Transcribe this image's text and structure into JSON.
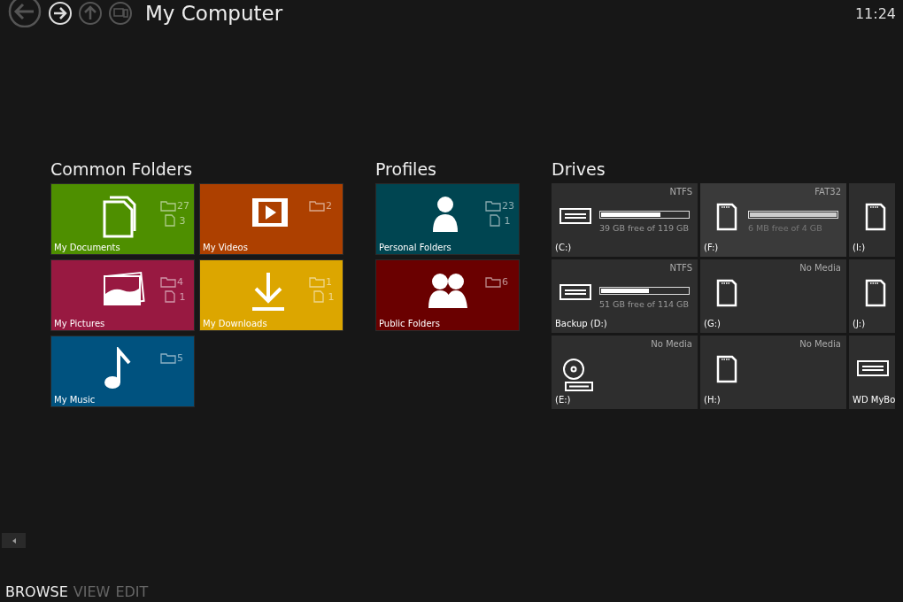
{
  "nav": [
    {
      "kind": "back",
      "disabled": true
    },
    {
      "kind": "forward",
      "disabled": false
    },
    {
      "kind": "up",
      "disabled": true
    },
    {
      "kind": "computer",
      "disabled": true
    }
  ],
  "title": "My Computer",
  "clock": "11:24",
  "common_folders": {
    "title": "Common Folders",
    "tiles": [
      {
        "label": "My Documents",
        "kind": "documents",
        "color": "#4e8f00",
        "folders": "27",
        "files": "3"
      },
      {
        "label": "My Videos",
        "kind": "videos",
        "color": "#ad4000",
        "folders": "2"
      },
      {
        "label": "My Pictures",
        "kind": "pictures",
        "color": "#981941",
        "folders": "4",
        "files": "1"
      },
      {
        "label": "My Downloads",
        "kind": "downloads",
        "color": "#dca600",
        "folders": "1",
        "files": "1"
      },
      {
        "label": "My Music",
        "kind": "music",
        "color": "#00527f",
        "folders": "5"
      }
    ]
  },
  "profiles": {
    "title": "Profiles",
    "tiles": [
      {
        "label": "Personal Folders",
        "kind": "person",
        "color": "#004551",
        "folders": "23",
        "files": "1"
      },
      {
        "label": "Public Folders",
        "kind": "people",
        "color": "#6a0000",
        "folders": "6"
      }
    ]
  },
  "drives": {
    "title": "Drives",
    "items": [
      {
        "label": "(C:)",
        "kind": "hdd",
        "fs": "NTFS",
        "level": 0.68,
        "space": "39 GB free of 119 GB",
        "selected": false
      },
      {
        "label": "Backup (D:)",
        "kind": "hdd",
        "fs": "NTFS",
        "level": 0.55,
        "space": "51 GB free of 114 GB",
        "selected": false
      },
      {
        "label": "(E:)",
        "kind": "optical",
        "fs": "No Media",
        "selected": false
      },
      {
        "label": "(F:)",
        "kind": "sd",
        "fs": "FAT32",
        "level": 1.0,
        "space": "6 MB free of 4 GB",
        "selected": true
      },
      {
        "label": "(G:)",
        "kind": "sd",
        "fs": "No Media",
        "selected": false
      },
      {
        "label": "(H:)",
        "kind": "sd",
        "fs": "No Media",
        "selected": false
      },
      {
        "label": "(I:)",
        "kind": "sd",
        "selected": false
      },
      {
        "label": "(J:)",
        "kind": "sd",
        "selected": false
      },
      {
        "label": "WD MyBo",
        "kind": "hdd",
        "selected": false
      }
    ]
  },
  "bottom_tabs": [
    {
      "label": "BROWSE",
      "selected": true
    },
    {
      "label": "VIEW",
      "selected": false
    },
    {
      "label": "EDIT",
      "selected": false
    }
  ]
}
